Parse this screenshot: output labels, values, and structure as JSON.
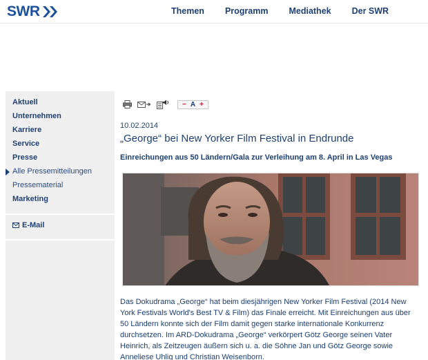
{
  "header": {
    "logo_text": "SWR",
    "nav": [
      "Themen",
      "Programm",
      "Mediathek",
      "Der SWR"
    ]
  },
  "sidebar": {
    "items": [
      {
        "label": "Aktuell"
      },
      {
        "label": "Unternehmen"
      },
      {
        "label": "Karriere"
      },
      {
        "label": "Service"
      },
      {
        "label": "Presse"
      },
      {
        "label": "Alle Pressemitteilungen"
      },
      {
        "label": "Pressematerial"
      },
      {
        "label": "Marketing"
      }
    ],
    "email_label": "E-Mail"
  },
  "toolbar": {
    "icons": [
      "print-icon",
      "email-icon",
      "read-aloud-icon"
    ],
    "font_minus": "−",
    "font_a": "A",
    "font_plus": "+"
  },
  "article": {
    "date": "10.02.2014",
    "headline": "„George“ bei New Yorker Film Festival in Endrunde",
    "subline": "Einreichungen aus 50 Ländern/Gala zur Verleihung am 8. April in Las Vegas",
    "body": "Das Dokudrama „George“ hat beim diesjährigen New Yorker Film Festival (2014 New York Festivals World's Best TV & Film) das Finale erreicht. Mit Einreichungen aus über 50 Ländern konnte sich der Film damit gegen starke internationale Konkurrenz durchsetzen. Im ARD-Dokudrama „George“ verkörpert Götz George seinen Vater Heinrich, als Zeitzeugen äußern sich u. a. die Söhne Jan und Götz George sowie Anneliese Uhlig und Christian Weisenborn."
  },
  "colors": {
    "brand": "#1d4f9c",
    "nav_text": "#1e3f73",
    "sidebar_bg": "#f0f0f0",
    "accent_red": "#c8102e"
  }
}
